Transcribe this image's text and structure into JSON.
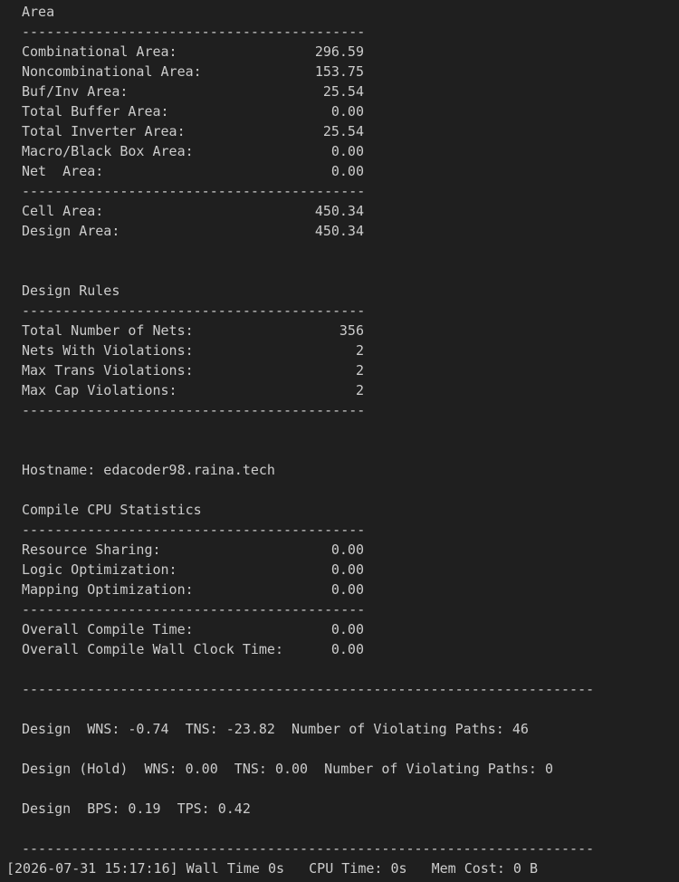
{
  "area": {
    "title": "Area",
    "separator": "------------------------------------------",
    "rows": [
      {
        "label": "Combinational Area:",
        "value": "296.59"
      },
      {
        "label": "Noncombinational Area:",
        "value": "153.75"
      },
      {
        "label": "Buf/Inv Area:",
        "value": "25.54"
      },
      {
        "label": "Total Buffer Area:",
        "value": "0.00"
      },
      {
        "label": "Total Inverter Area:",
        "value": "25.54"
      },
      {
        "label": "Macro/Black Box Area:",
        "value": "0.00"
      },
      {
        "label": "Net  Area:",
        "value": "0.00"
      }
    ],
    "totals": [
      {
        "label": "Cell Area:",
        "value": "450.34"
      },
      {
        "label": "Design Area:",
        "value": "450.34"
      }
    ]
  },
  "design_rules": {
    "title": "Design Rules",
    "separator": "------------------------------------------",
    "rows": [
      {
        "label": "Total Number of Nets:",
        "value": "356"
      },
      {
        "label": "Nets With Violations:",
        "value": "2"
      },
      {
        "label": "Max Trans Violations:",
        "value": "2"
      },
      {
        "label": "Max Cap Violations:",
        "value": "2"
      }
    ]
  },
  "hostname": "Hostname: edacoder98.raina.tech",
  "cpu_stats": {
    "title": "Compile CPU Statistics",
    "separator": "------------------------------------------",
    "rows": [
      {
        "label": "Resource Sharing:",
        "value": "0.00"
      },
      {
        "label": "Logic Optimization:",
        "value": "0.00"
      },
      {
        "label": "Mapping Optimization:",
        "value": "0.00"
      }
    ],
    "totals": [
      {
        "label": "Overall Compile Time:",
        "value": "0.00"
      },
      {
        "label": "Overall Compile Wall Clock Time:",
        "value": "0.00"
      }
    ]
  },
  "long_separator": "----------------------------------------------------------------------",
  "timing": {
    "setup": "Design  WNS: -0.74  TNS: -23.82  Number of Violating Paths: 46",
    "hold": "Design (Hold)  WNS: 0.00  TNS: 0.00  Number of Violating Paths: 0",
    "bps": "Design  BPS: 0.19  TPS: 0.42"
  },
  "status_line": "[2026-07-31 15:17:16] Wall Time 0s   CPU Time: 0s   Mem Cost: 0 B"
}
